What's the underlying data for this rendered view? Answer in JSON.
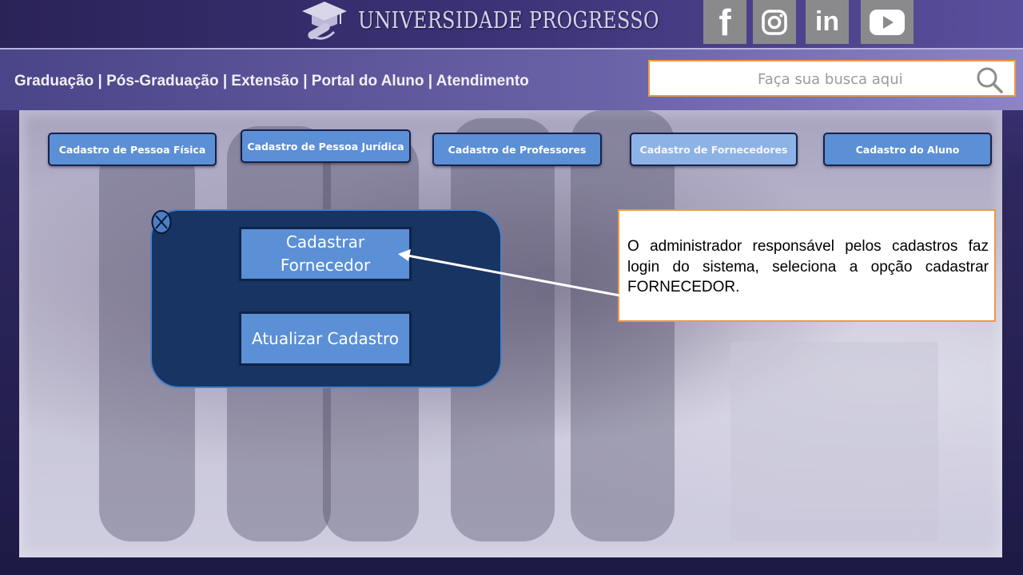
{
  "brand": {
    "name": "UNIVERSIDADE PROGRESSO",
    "logo_icon": "graduation-cap-icon"
  },
  "social": [
    {
      "name": "facebook",
      "glyph": "f"
    },
    {
      "name": "instagram",
      "glyph": ""
    },
    {
      "name": "linkedin",
      "glyph": "in"
    },
    {
      "name": "youtube",
      "glyph": ""
    }
  ],
  "nav": {
    "text": "Graduação | Pós-Graduação | Extensão | Portal do Aluno | Atendimento"
  },
  "search": {
    "placeholder": "Faça sua busca aqui",
    "icon": "search-icon"
  },
  "tabs": [
    {
      "label": "Cadastro de Pessoa Física",
      "active": false
    },
    {
      "label": "Cadastro de Pessoa Jurídica",
      "active": false
    },
    {
      "label": "Cadastro de Professores",
      "active": false
    },
    {
      "label": "Cadastro de  Fornecedores",
      "active": true
    },
    {
      "label": "Cadastro do Aluno",
      "active": false
    }
  ],
  "modal": {
    "close_icon": "close-icon",
    "primary_label": "Cadastrar Fornecedor",
    "secondary_label": "Atualizar Cadastro"
  },
  "callout": {
    "text": "O administrador responsável pelos cadastros faz login do sistema, seleciona a opção cadastrar FORNECEDOR."
  },
  "colors": {
    "accent_orange": "#ee9a42",
    "button_blue": "#5b8fd6",
    "modal_navy": "#173462"
  }
}
